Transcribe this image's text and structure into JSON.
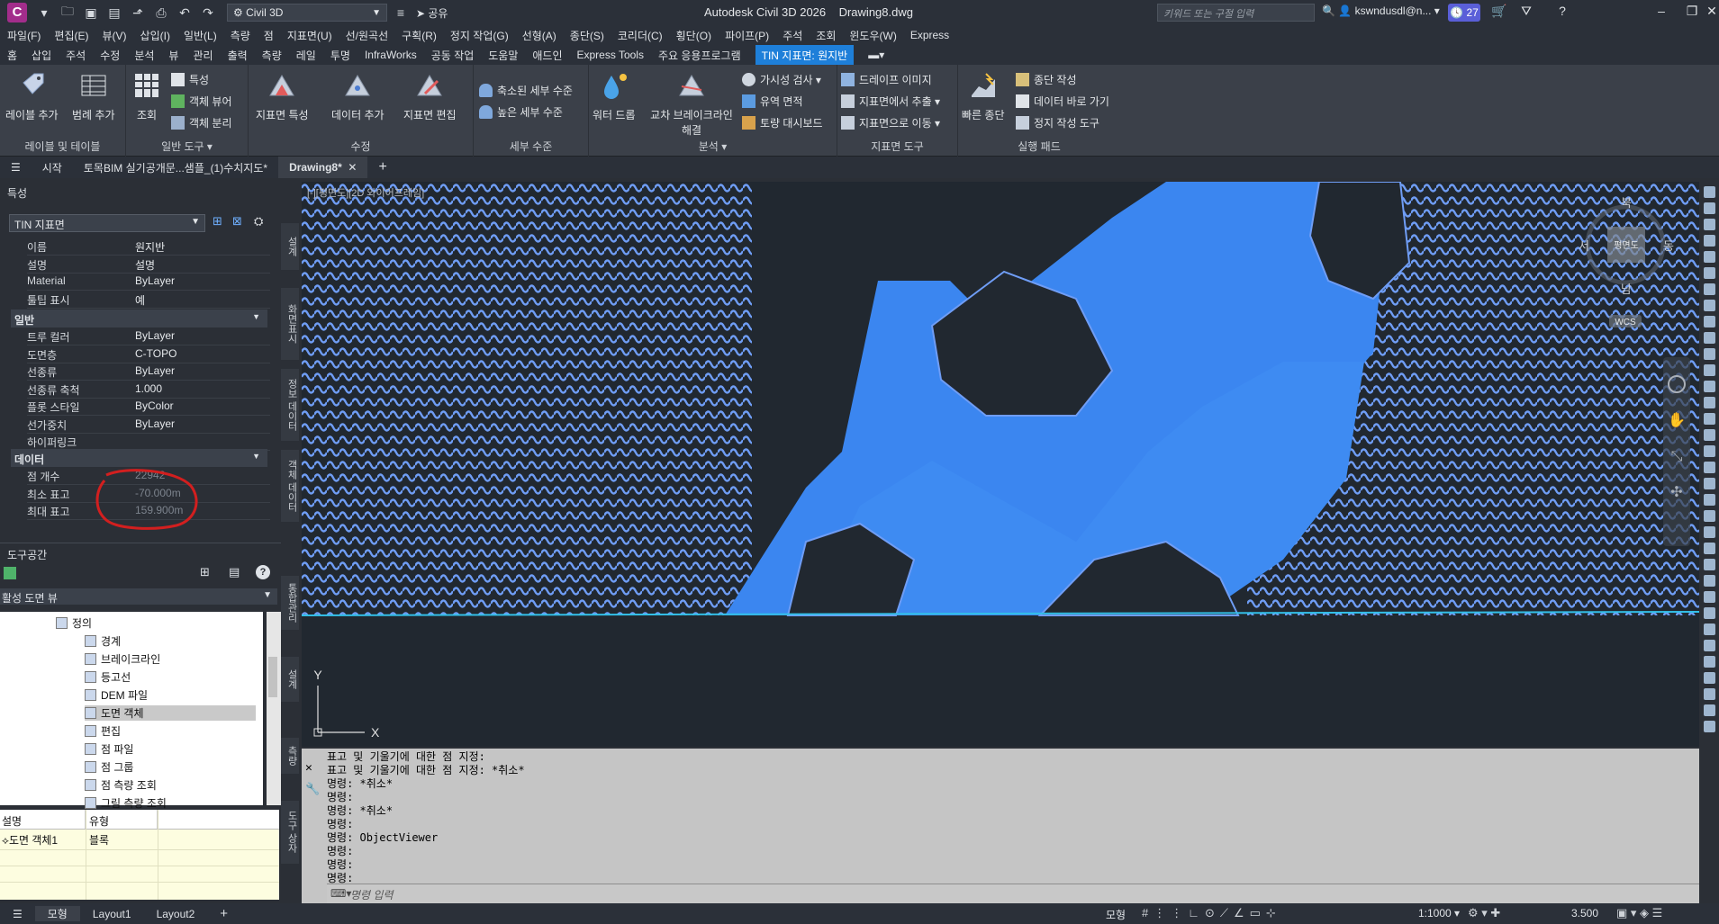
{
  "titlebar": {
    "logo": "C",
    "workspace": "Civil 3D",
    "share": "공유",
    "app_title": "Autodesk Civil 3D 2026",
    "doc_title": "Drawing8.dwg",
    "search_placeholder": "키워드 또는 구절 입력",
    "user": "kswndusdl@n...",
    "badge_count": "27"
  },
  "menubar": [
    "파일(F)",
    "편집(E)",
    "뷰(V)",
    "삽입(I)",
    "일반(L)",
    "측량",
    "점",
    "지표면(U)",
    "선/원곡선",
    "구획(R)",
    "정지 작업(G)",
    "선형(A)",
    "종단(S)",
    "코리더(C)",
    "횡단(O)",
    "파이프(P)",
    "주석",
    "조회",
    "윈도우(W)",
    "Express"
  ],
  "ribbon_tabs": [
    "홈",
    "삽입",
    "주석",
    "수정",
    "분석",
    "뷰",
    "관리",
    "출력",
    "측량",
    "레일",
    "투명",
    "InfraWorks",
    "공동 작업",
    "도움말",
    "애드인",
    "Express Tools",
    "주요 응용프로그램",
    "TIN 지표면: 원지반"
  ],
  "ribbon": {
    "labels_panel": {
      "title": "레이블 및 테이블",
      "btn1": "레이블 추가",
      "btn2": "범례 추가"
    },
    "general_panel": {
      "title": "일반 도구",
      "lookup": "조회",
      "props": "특성",
      "viewer": "객체 뷰어",
      "isolate": "객체 분리"
    },
    "modify_panel": {
      "title": "수정",
      "surface_props": "지표면 특성",
      "add_data": "데이터 추가",
      "edit_surface": "지표면 편집"
    },
    "detail_panel": {
      "title": "세부 수준",
      "reduced": "축소된 세부 수준",
      "high": "높은 세부 수준"
    },
    "analyze_panel": {
      "title": "분석",
      "water_drop": "워터 드롭",
      "breakline": "교차 브레이크라인 해결",
      "visibility": "가시성 검사",
      "catchment": "유역 면적",
      "mass": "토량 대시보드"
    },
    "surface_panel": {
      "title": "지표면 도구",
      "drape": "드레이프 이미지",
      "extract": "지표면에서 추출",
      "move_to": "지표면으로 이동"
    },
    "launch_panel": {
      "title": "실행 패드",
      "quick_profile": "빠른 종단",
      "create_profile": "종단 작성",
      "data_shortcut": "데이터 바로 가기",
      "grading": "정지 작성 도구"
    }
  },
  "doctabs": {
    "start": "시작",
    "tab1": "토목BIM 실기공개문...샘플_(1)수치지도*",
    "tab2": "Drawing8*"
  },
  "properties": {
    "header": "특성",
    "object_type": "TIN 지표면",
    "rows_top": [
      {
        "k": "이름",
        "v": "원지반"
      },
      {
        "k": "설명",
        "v": "설명"
      },
      {
        "k": "Material",
        "v": "ByLayer"
      },
      {
        "k": "툴팁 표시",
        "v": "예"
      }
    ],
    "general_title": "일반",
    "rows_general": [
      {
        "k": "트루 컬러",
        "v": "ByLayer"
      },
      {
        "k": "도면층",
        "v": "C-TOPO"
      },
      {
        "k": "선종류",
        "v": "ByLayer"
      },
      {
        "k": "선종류 축척",
        "v": "1.000"
      },
      {
        "k": "플롯 스타일",
        "v": "ByColor"
      },
      {
        "k": "선가중치",
        "v": "ByLayer"
      },
      {
        "k": "하이퍼링크",
        "v": ""
      }
    ],
    "data_title": "데이터",
    "rows_data": [
      {
        "k": "점 개수",
        "v": "22942"
      },
      {
        "k": "최소 표고",
        "v": "-70.000m"
      },
      {
        "k": "최대 표고",
        "v": "159.900m"
      }
    ],
    "side_tabs": [
      "설계",
      "화면표시",
      "정보 데이터",
      "객체 데이터"
    ]
  },
  "toolspace": {
    "header": "도구공간",
    "view": "활성 도면 뷰",
    "tree": [
      {
        "label": "정의",
        "indent": 3
      },
      {
        "label": "경계",
        "indent": 5
      },
      {
        "label": "브레이크라인",
        "indent": 5
      },
      {
        "label": "등고선",
        "indent": 5
      },
      {
        "label": "DEM 파일",
        "indent": 5
      },
      {
        "label": "도면 객체",
        "indent": 5
      },
      {
        "label": "편집",
        "indent": 5
      },
      {
        "label": "점 파일",
        "indent": 5
      },
      {
        "label": "점 그룹",
        "indent": 5
      },
      {
        "label": "점 측량 조회",
        "indent": 5
      },
      {
        "label": "그림 측량 조회",
        "indent": 5
      }
    ],
    "list_headers": [
      "설명",
      "유형"
    ],
    "list_row": {
      "name": "도면 객체1",
      "type": "블록"
    },
    "side_tabs": [
      "통합관리",
      "설계",
      "측량",
      "도구 상자"
    ]
  },
  "canvas": {
    "viewport_label": "[-][평면도][2D 와이어프레임]",
    "compass": {
      "n": "북",
      "s": "남",
      "w": "서",
      "e": "동",
      "center": "평면도",
      "wcs": "WCS"
    },
    "ucs_x": "X",
    "ucs_y": "Y"
  },
  "command": {
    "lines": [
      "표고 및 기울기에 대한 점 지정:",
      "표고 및 기울기에 대한 점 지정: *취소*",
      "명령: *취소*",
      "명령:",
      "명령: *취소*",
      "명령:",
      "명령: ObjectViewer",
      "명령:",
      "명령:",
      "명령:"
    ],
    "placeholder": "명령 입력"
  },
  "status": {
    "tabs": [
      "모형",
      "Layout1",
      "Layout2"
    ],
    "model": "모형",
    "scale": "1:1000",
    "annot": "3.500"
  },
  "colors": {
    "accent": "#1e7fd9",
    "surface_fill": "#3b86f0",
    "contour": "#6f9df5",
    "badge": "#5a5fd8"
  }
}
